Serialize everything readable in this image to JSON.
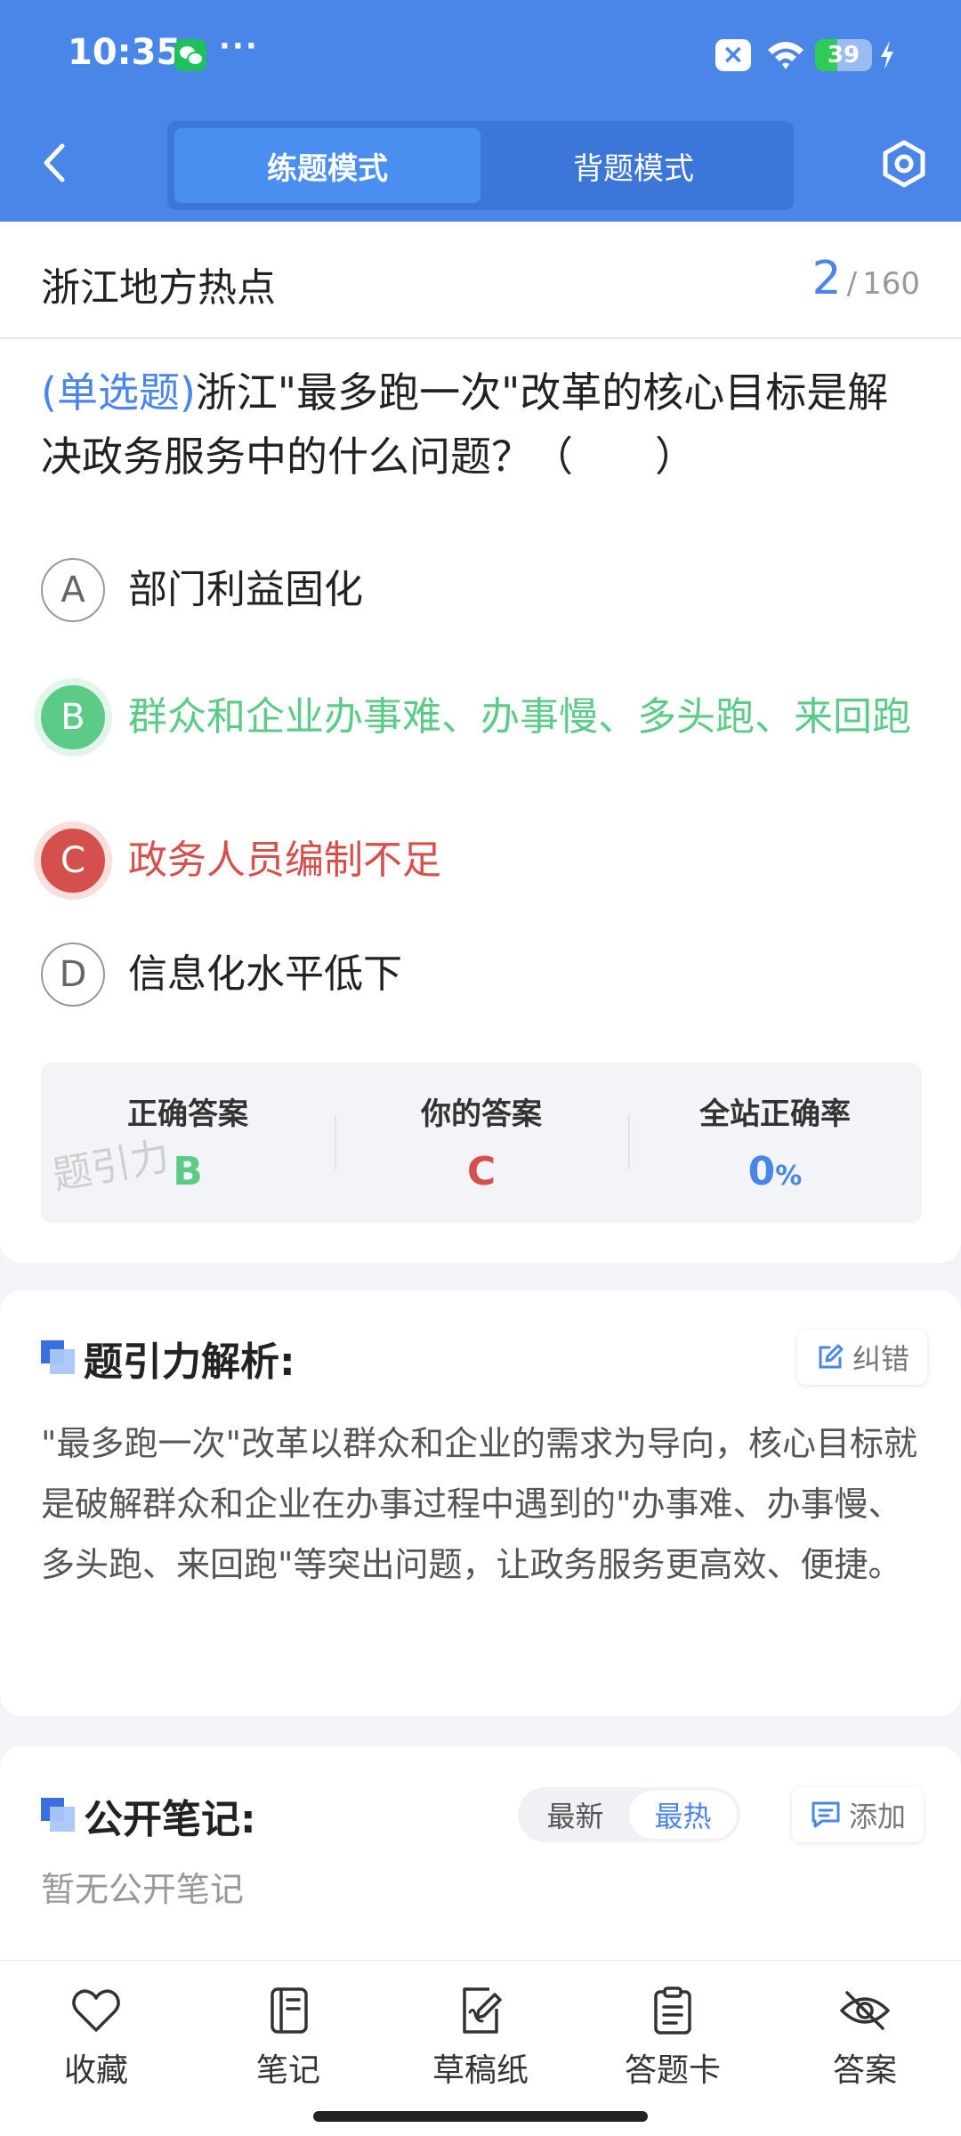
{
  "status_bar": {
    "time": "10:35",
    "more": "···",
    "battery_level": "39",
    "battery_fraction": 0.39,
    "icons": [
      "wechat-icon",
      "close-notification-icon",
      "wifi-icon",
      "battery-icon",
      "charging-icon"
    ]
  },
  "header": {
    "back_icon": "chevron-left-icon",
    "modes": [
      {
        "label": "练题模式",
        "active": true
      },
      {
        "label": "背题模式",
        "active": false
      }
    ],
    "settings_icon": "hexagon-settings-icon"
  },
  "title_bar": {
    "title": "浙江地方热点",
    "current": "2",
    "separator": "/",
    "total": "160"
  },
  "question": {
    "type": "(单选题)",
    "text": "浙江\"最多跑一次\"改革的核心目标是解决政务服务中的什么问题？（　　）",
    "options": [
      {
        "letter": "A",
        "text": "部门利益固化",
        "state": "normal"
      },
      {
        "letter": "B",
        "text": "群众和企业办事难、办事慢、多头跑、来回跑",
        "state": "correct"
      },
      {
        "letter": "C",
        "text": "政务人员编制不足",
        "state": "wrong"
      },
      {
        "letter": "D",
        "text": "信息化水平低下",
        "state": "normal"
      }
    ]
  },
  "answer_summary": {
    "correct_label": "正确答案",
    "correct_value": "B",
    "yours_label": "你的答案",
    "yours_value": "C",
    "rate_label": "全站正确率",
    "rate_value": "0",
    "rate_unit": "%",
    "watermark": "题引力"
  },
  "analysis": {
    "title": "题引力解析:",
    "report_label": "纠错",
    "report_icon": "edit-icon",
    "text": "\"最多跑一次\"改革以群众和企业的需求为导向，核心目标就是破解群众和企业在办事过程中遇到的\"办事难、办事慢、多头跑、来回跑\"等突出问题，让政务服务更高效、便捷。"
  },
  "notes": {
    "title": "公开笔记:",
    "sort_options": [
      {
        "label": "最新",
        "active": false
      },
      {
        "label": "最热",
        "active": true
      }
    ],
    "add_label": "添加",
    "add_icon": "comment-icon",
    "empty_text": "暂无公开笔记"
  },
  "bottom_nav": [
    {
      "label": "收藏",
      "icon": "heart-icon"
    },
    {
      "label": "笔记",
      "icon": "notebook-icon"
    },
    {
      "label": "草稿纸",
      "icon": "draft-paper-icon"
    },
    {
      "label": "答题卡",
      "icon": "clipboard-icon"
    },
    {
      "label": "答案",
      "icon": "eye-off-icon"
    }
  ],
  "colors": {
    "primary": "#4a86e8",
    "correct": "#5ccb88",
    "wrong": "#d4504d"
  }
}
